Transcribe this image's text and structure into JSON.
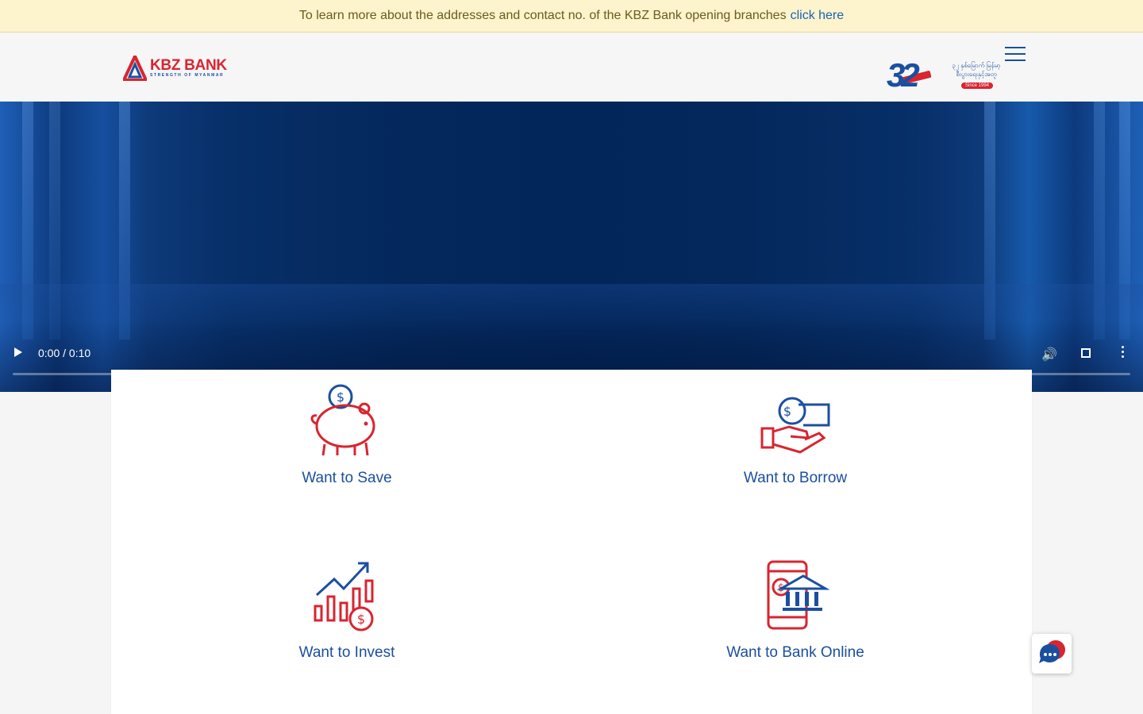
{
  "notice": {
    "text": "To learn more about the addresses and contact no. of the KBZ Bank opening branches",
    "link": "click here"
  },
  "header": {
    "logo_name": "KBZ BANK",
    "logo_tagline": "STRENGTH OF MYANMAR",
    "anniversary_number": "32",
    "anniversary_script": "၃၂ နှစ်မြောက်\nမြန်မာ့စီးပွားရေးနှင့်အတူ",
    "anniversary_since": "Since 1994"
  },
  "video": {
    "time": "0:00 / 0:10",
    "progress": 0
  },
  "services": [
    {
      "label": "Want to Save",
      "icon": "piggy-bank-icon"
    },
    {
      "label": "Want to Borrow",
      "icon": "hand-coin-icon"
    },
    {
      "label": "Want to Invest",
      "icon": "growth-chart-icon"
    },
    {
      "label": "Want to Bank Online",
      "icon": "mobile-banking-icon"
    }
  ],
  "colors": {
    "brand_blue": "#1b4fa0",
    "brand_red": "#d82530",
    "notice_bg": "#fdf3cd"
  }
}
